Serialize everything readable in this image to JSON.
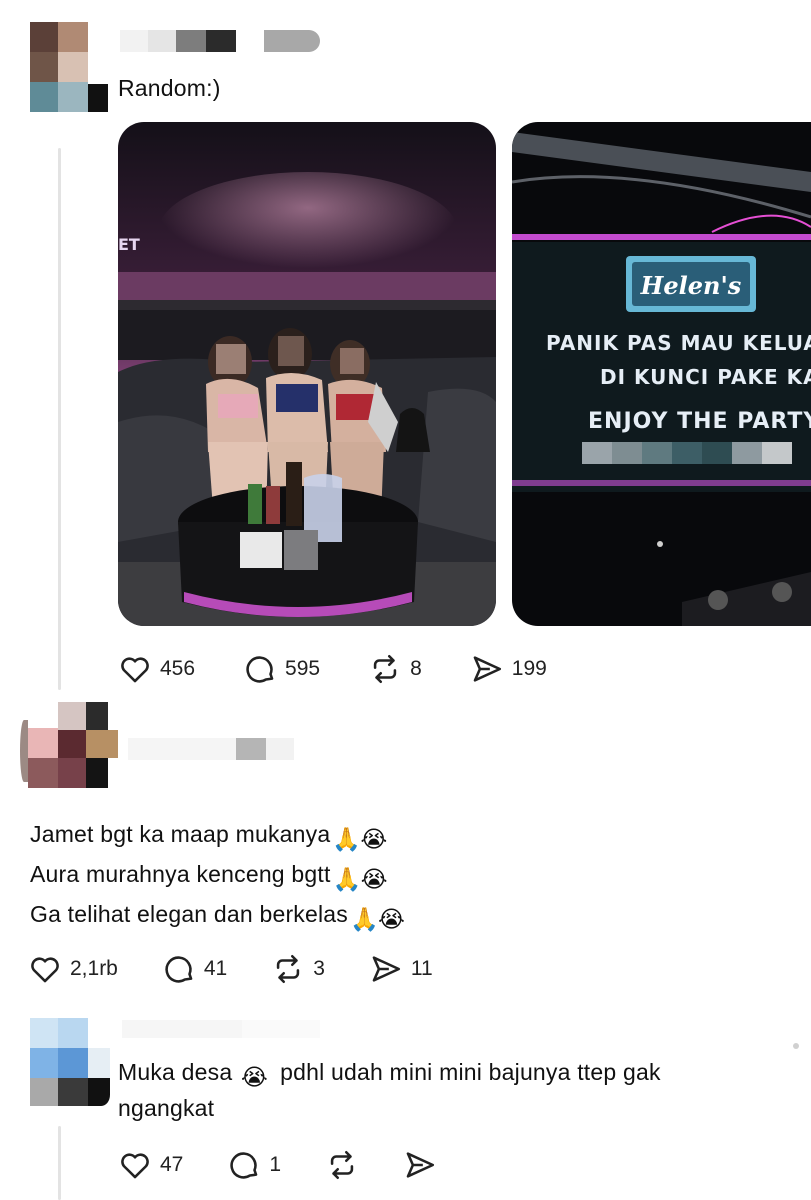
{
  "posts": [
    {
      "text": "Random:)",
      "image_sign": {
        "logo": "Helen's",
        "line1": "PANIK PAS MAU KELUAR",
        "line2": "DI KUNCI PAKE KAKI",
        "line3": "ENJOY THE PARTY"
      },
      "image_tag_left": "ET",
      "stats": {
        "likes": "456",
        "comments": "595",
        "reposts": "8",
        "shares": "199"
      }
    },
    {
      "lines": [
        "Jamet bgt ka maap mukanya",
        "Aura murahnya kenceng bgtt",
        "Ga telihat elegan dan berkelas"
      ],
      "stats": {
        "likes": "2,1rb",
        "comments": "41",
        "reposts": "3",
        "shares": "11"
      }
    },
    {
      "text_before_emoji": "Muka desa",
      "text_after_emoji": "pdhl udah mini mini bajunya ttep gak",
      "text_line2": "ngangkat",
      "stats": {
        "likes": "47",
        "comments": "1"
      }
    }
  ],
  "icons": [
    "heart-icon",
    "comment-icon",
    "repost-icon",
    "share-icon",
    "pray-emoji",
    "crying-emoji",
    "more-options-icon"
  ],
  "colors": {
    "text": "#111111",
    "thread_line": "#e3e3e3",
    "club_pink": "#b0307a"
  }
}
